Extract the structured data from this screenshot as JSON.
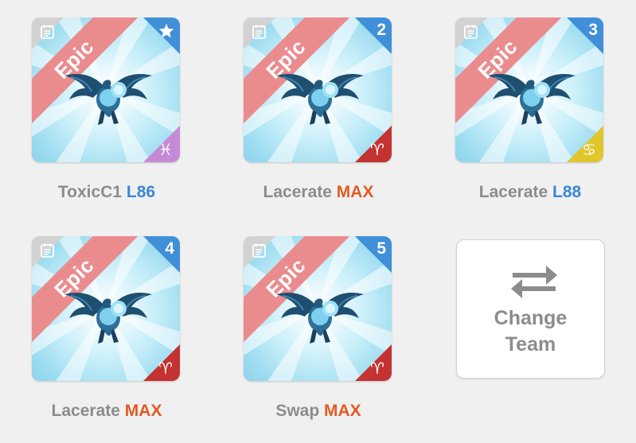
{
  "team": {
    "members": [
      {
        "name": "ToxicC1",
        "level": "L86",
        "rarity": "Epic",
        "rank_badge": "",
        "rank_icon": "star-icon",
        "sign_icon": "pisces-icon",
        "sign_glyph": "♓",
        "accent_color": "#3a86d4"
      },
      {
        "name": "Lacerate",
        "level": "MAX",
        "rarity": "Epic",
        "rank_badge": "2",
        "sign_icon": "aries-icon",
        "sign_glyph": "♈",
        "accent_color": "#e25a22"
      },
      {
        "name": "Lacerate",
        "level": "L88",
        "rarity": "Epic",
        "rank_badge": "3",
        "sign_icon": "cancer-icon",
        "sign_glyph": "♋",
        "accent_color": "#3a86d4"
      },
      {
        "name": "Lacerate",
        "level": "MAX",
        "rarity": "Epic",
        "rank_badge": "4",
        "sign_icon": "aries-icon",
        "sign_glyph": "♈",
        "accent_color": "#e25a22"
      },
      {
        "name": "Swap",
        "level": "MAX",
        "rarity": "Epic",
        "rank_badge": "5",
        "sign_icon": "aries-icon",
        "sign_glyph": "♈",
        "accent_color": "#e25a22"
      }
    ],
    "change_button": {
      "line1": "Change",
      "line2": "Team",
      "icon": "swap-arrows-icon"
    }
  },
  "colors": {
    "rarity_ribbon": "#ea8c8e",
    "rank_corner": "#3f8fd9",
    "level_blue": "#3a86d4",
    "level_max": "#e25a22",
    "name_gray": "#8c8c8c"
  }
}
